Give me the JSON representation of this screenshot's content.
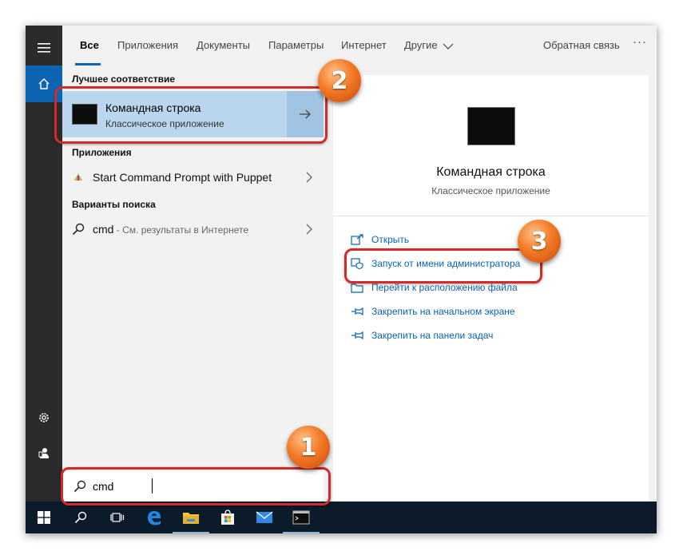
{
  "tabs": [
    {
      "label": "Все",
      "active": true
    },
    {
      "label": "Приложения"
    },
    {
      "label": "Документы"
    },
    {
      "label": "Параметры"
    },
    {
      "label": "Интернет"
    },
    {
      "label": "Другие"
    }
  ],
  "feedback_label": "Обратная связь",
  "more_label": "···",
  "sections": {
    "best_match": "Лучшее соответствие",
    "apps": "Приложения",
    "search_suggestions": "Варианты поиска"
  },
  "best_match": {
    "title": "Командная строка",
    "subtitle": "Классическое приложение"
  },
  "apps": [
    {
      "label": "Start Command Prompt with Puppet"
    }
  ],
  "suggestions": [
    {
      "query": "cmd",
      "suffix": " - См. результаты в Интернете"
    }
  ],
  "preview": {
    "title": "Командная строка",
    "subtitle": "Классическое приложение",
    "actions": [
      {
        "label": "Открыть",
        "icon": "open-icon"
      },
      {
        "label": "Запуск от имени администратора",
        "icon": "shield-icon"
      },
      {
        "label": "Перейти к расположению файла",
        "icon": "folder-icon"
      },
      {
        "label": "Закрепить на начальном экране",
        "icon": "pin-icon"
      },
      {
        "label": "Закрепить на панели задач",
        "icon": "pin-icon"
      }
    ]
  },
  "search": {
    "value": "cmd"
  },
  "badges": [
    "1",
    "2",
    "3"
  ],
  "colors": {
    "accent": "#0c64b3",
    "selected": "#b9d6ee",
    "link": "#0a63b4",
    "annotation": "#d32a2a",
    "taskbar": "#0c1b2a"
  }
}
